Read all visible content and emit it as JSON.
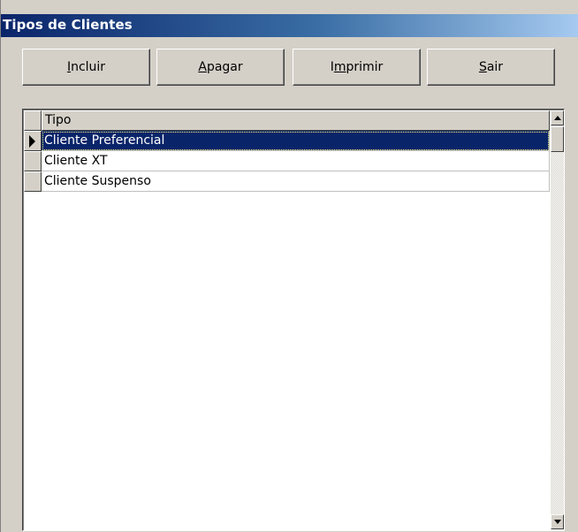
{
  "window": {
    "title": "Tipos de Clientes"
  },
  "toolbar": {
    "buttons": [
      {
        "pre": "",
        "accel": "I",
        "post": "ncluir"
      },
      {
        "pre": "",
        "accel": "A",
        "post": "pagar"
      },
      {
        "pre": "I",
        "accel": "m",
        "post": "primir"
      },
      {
        "pre": "",
        "accel": "S",
        "post": "air"
      }
    ]
  },
  "grid": {
    "column_header": "Tipo",
    "rows": [
      {
        "tipo": "Cliente Preferencial",
        "selected": true
      },
      {
        "tipo": "Cliente XT",
        "selected": false
      },
      {
        "tipo": "Cliente Suspenso",
        "selected": false
      }
    ]
  },
  "colors": {
    "selection_bg": "#0a246a",
    "title_gradient_start": "#0a246a",
    "face": "#d4d0c8"
  }
}
